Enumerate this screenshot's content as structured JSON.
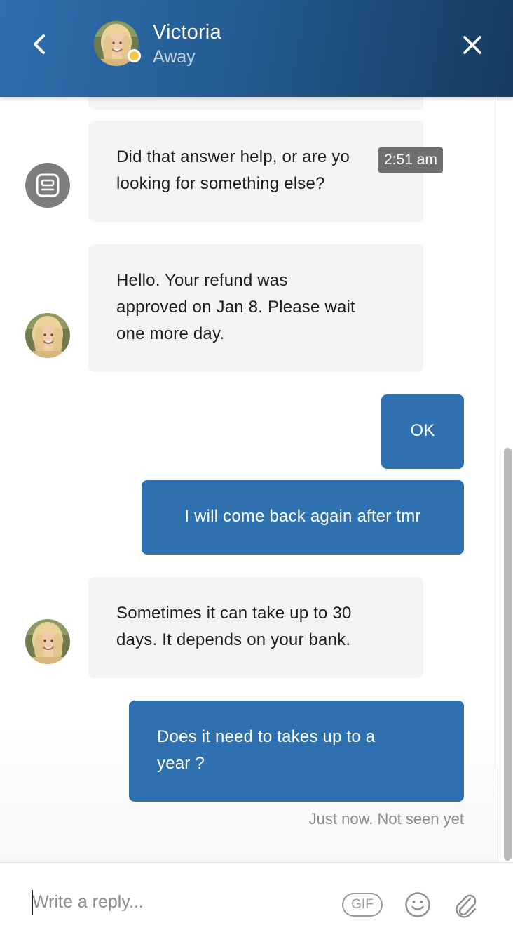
{
  "header": {
    "back_icon": "chevron-left-icon",
    "agent_name": "Victoria",
    "agent_status": "Away",
    "status_color": "#f2c94c",
    "close_icon": "close-icon",
    "background": "#2a64a0"
  },
  "messages": [
    {
      "sender": "bot",
      "avatar": "bot-icon",
      "text": "Did that answer help, or are you looking for something else?",
      "line1": "Did that answer help, or are yo",
      "line2": "looking for something else?",
      "hover_time": "2:51 am"
    },
    {
      "sender": "agent",
      "avatar": "agent-avatar",
      "text": "Hello. Your refund was approved on Jan 8. Please wait one more day.",
      "line1": "Hello. Your refund was",
      "line2": "approved on Jan 8. Please wait",
      "line3": "one more day."
    },
    {
      "sender": "user",
      "text": "OK"
    },
    {
      "sender": "user",
      "text": "I will come back again after tmr"
    },
    {
      "sender": "agent",
      "avatar": "agent-avatar",
      "text": "Sometimes it can take up to 30 days. It depends on your bank.",
      "line1": "Sometimes it can take up to 30",
      "line2": "days. It depends on your bank."
    },
    {
      "sender": "user",
      "text": "Does it need to takes up to a year ?",
      "line1": "Does it need to takes up to a",
      "line2": "year ?"
    }
  ],
  "seen_status": "Just now. Not seen yet",
  "composer": {
    "placeholder": "Write a reply...",
    "gif_label": "GIF",
    "emoji_icon": "smiley-icon",
    "attach_icon": "paperclip-icon"
  },
  "colors": {
    "user_bubble": "#2f70b0",
    "agent_bubble": "#f4f4f4",
    "bot_avatar": "#7d7d7d"
  }
}
